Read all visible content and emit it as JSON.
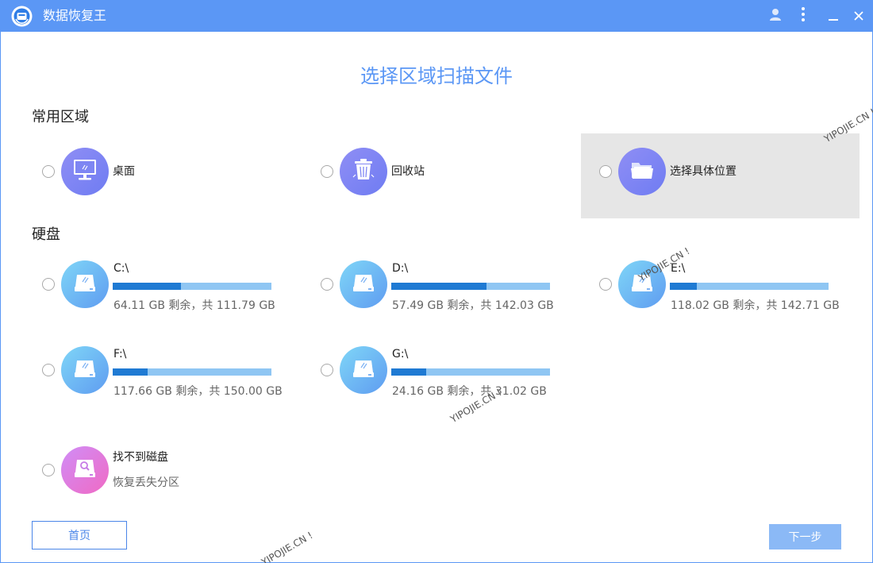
{
  "window": {
    "title": "数据恢复王"
  },
  "page": {
    "title": "选择区域扫描文件"
  },
  "sections": {
    "common": "常用区域",
    "disks": "硬盘"
  },
  "common_areas": [
    {
      "label": "桌面",
      "icon": "desktop-icon"
    },
    {
      "label": "回收站",
      "icon": "recycle-bin-icon"
    },
    {
      "label": "选择具体位置",
      "icon": "folder-icon"
    }
  ],
  "drives": [
    {
      "name": "C:\\",
      "info": "64.11 GB 剩余，共 111.79 GB",
      "used_fraction": 0.43
    },
    {
      "name": "D:\\",
      "info": "57.49 GB 剩余，共 142.03 GB",
      "used_fraction": 0.6
    },
    {
      "name": "E:\\",
      "info": "118.02 GB 剩余，共 142.71 GB",
      "used_fraction": 0.17
    },
    {
      "name": "F:\\",
      "info": "117.66 GB 剩余，共 150.00 GB",
      "used_fraction": 0.22
    },
    {
      "name": "G:\\",
      "info": "24.16 GB 剩余，共 31.02 GB",
      "used_fraction": 0.22
    }
  ],
  "lost_disk": {
    "title": "找不到磁盘",
    "subtitle": "恢复丢失分区"
  },
  "buttons": {
    "home": "首页",
    "next": "下一步"
  },
  "watermark": "YIPOJIE.CN !",
  "colors": {
    "accent": "#5b97f5",
    "bar_fill": "#1f7ad3",
    "bar_track": "#8fc6f3"
  }
}
